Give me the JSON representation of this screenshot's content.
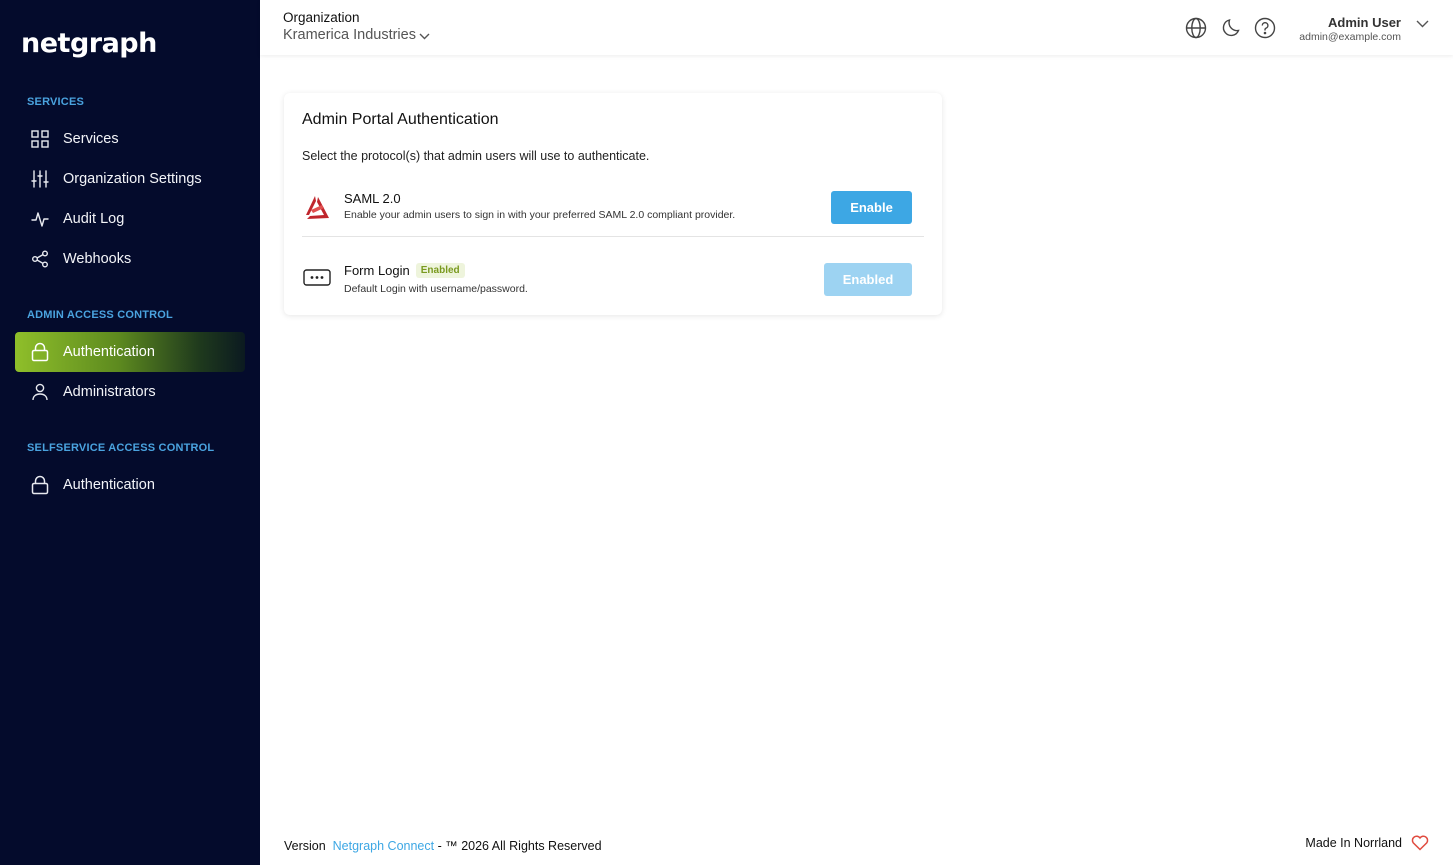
{
  "sidebar": {
    "logo": "netgraph",
    "sections": [
      {
        "title": "SERVICES",
        "items": [
          {
            "label": "Services",
            "icon": "grid-icon"
          },
          {
            "label": "Organization Settings",
            "icon": "sliders-icon"
          },
          {
            "label": "Audit Log",
            "icon": "activity-icon"
          },
          {
            "label": "Webhooks",
            "icon": "share-icon"
          }
        ]
      },
      {
        "title": "ADMIN ACCESS CONTROL",
        "items": [
          {
            "label": "Authentication",
            "icon": "lock-icon",
            "active": true
          },
          {
            "label": "Administrators",
            "icon": "user-icon"
          }
        ]
      },
      {
        "title": "SELFSERVICE ACCESS CONTROL",
        "items": [
          {
            "label": "Authentication",
            "icon": "lock-icon"
          }
        ]
      }
    ]
  },
  "header": {
    "org_label": "Organization",
    "org_name": "Kramerica Industries",
    "user_name": "Admin User",
    "user_email": "admin@example.com"
  },
  "card": {
    "title": "Admin Portal Authentication",
    "description": "Select the protocol(s) that admin users will use to authenticate.",
    "protocols": [
      {
        "name": "SAML 2.0",
        "description": "Enable your admin users to sign in with your preferred SAML 2.0 compliant provider.",
        "button": "Enable",
        "icon": "saml-logo-icon"
      },
      {
        "name": "Form Login",
        "badge": "Enabled",
        "description": "Default Login with username/password.",
        "button": "Enabled",
        "icon": "password-field-icon"
      }
    ]
  },
  "footer": {
    "version_label": "Version",
    "link_text": "Netgraph Connect",
    "rights": "- ™ 2026 All Rights Reserved",
    "made_in": "Made In Norrland"
  },
  "colors": {
    "sidebar_bg": "#040b2c",
    "accent_blue": "#3da7e4",
    "active_green": "#8fbf2a",
    "badge_green": "#7a9a1f",
    "heart_red": "#e04b3f"
  }
}
